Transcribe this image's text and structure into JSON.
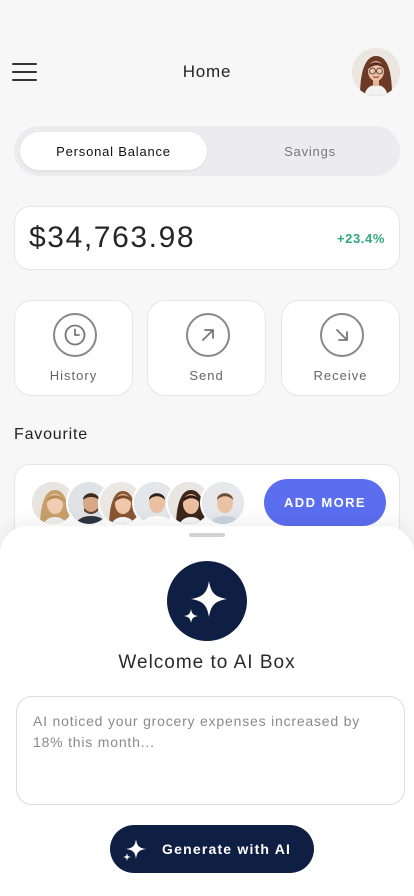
{
  "header": {
    "title": "Home",
    "menu_icon": "hamburger-menu-icon"
  },
  "tabs": [
    {
      "label": "Personal Balance",
      "active": true
    },
    {
      "label": "Savings",
      "active": false
    }
  ],
  "balance": {
    "amount": "$34,763.98",
    "change": "+23.4%",
    "change_color": "#2eaa7e"
  },
  "actions": [
    {
      "label": "History",
      "icon": "clock-icon"
    },
    {
      "label": "Send",
      "icon": "arrow-up-right-icon"
    },
    {
      "label": "Receive",
      "icon": "arrow-down-right-icon"
    }
  ],
  "favourite": {
    "title": "Favourite",
    "add_more_label": "ADD MORE",
    "accent": "#5b6ef0"
  },
  "ai_box": {
    "title": "Welcome to AI Box",
    "placeholder": "AI noticed your grocery expenses increased by 18% this month...",
    "generate_label": "Generate with AI",
    "dark": "#0f1f44"
  }
}
